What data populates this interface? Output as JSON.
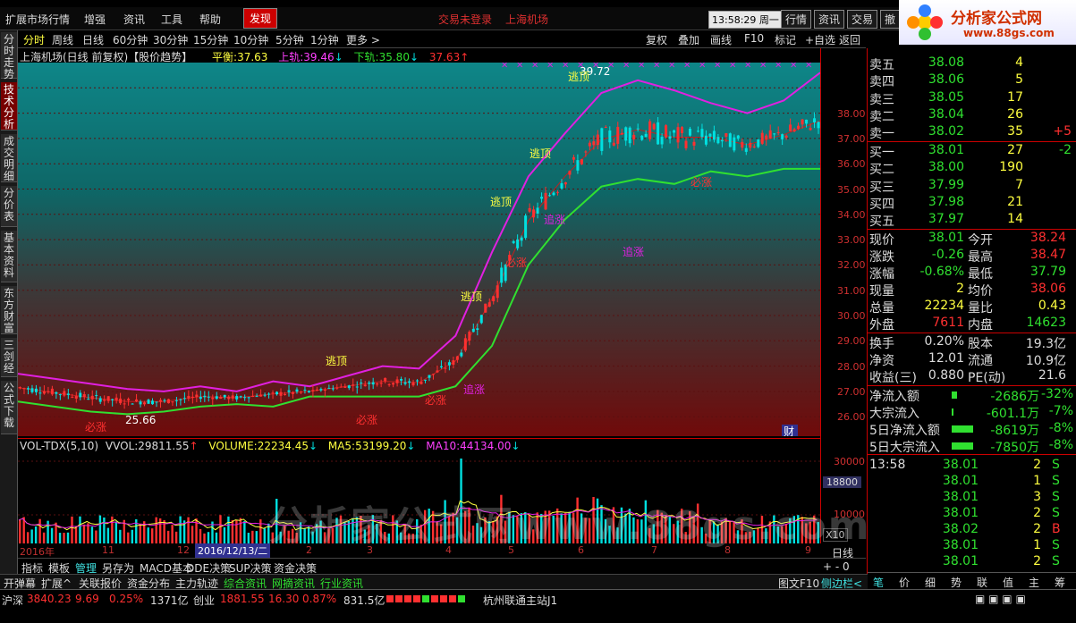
{
  "menubar": {
    "items": [
      "扩展市场行情",
      "增强",
      "资讯",
      "工具",
      "帮助"
    ],
    "active_tab": "发现",
    "status1": "交易未登录",
    "status2": "上海机场",
    "clock": "13:58:29 周一",
    "buttons": [
      "行情",
      "资讯",
      "交易",
      "撤"
    ]
  },
  "logo": {
    "title": "分析家公式网",
    "url": "www.88gs.com"
  },
  "toolbar": {
    "periods": [
      "分时",
      "周线",
      "日线",
      "60分钟",
      "30分钟",
      "15分钟",
      "10分钟",
      "5分钟",
      "1分钟",
      "更多 >"
    ],
    "tools": [
      "复权",
      "叠加",
      "画线",
      "F10",
      "标记",
      "+自选",
      "返回"
    ]
  },
  "left_rail": [
    "分时走势",
    "技术分析",
    "成交明细",
    "分价表",
    "基本资料",
    "东方财富",
    "三剑经",
    "公式下载"
  ],
  "chart_title": {
    "name": "上海机场(日线 前复权)【股价趋势】",
    "balance_label": "平衡:",
    "balance_value": "37.63",
    "upper_label": "上轨:",
    "upper_value": "39.46",
    "lower_label": "下轨:",
    "lower_value": "35.80",
    "extra_value": "37.63"
  },
  "price_axis": [
    "38.00",
    "37.00",
    "36.00",
    "35.00",
    "34.00",
    "33.00",
    "32.00",
    "31.00",
    "30.00",
    "29.00",
    "28.00",
    "27.00",
    "26.00"
  ],
  "annotations": {
    "high": "39.72",
    "low": "25.66",
    "escape": "逃顶",
    "chase": "追涨",
    "must": "必涨",
    "finance": "财"
  },
  "volume_title": {
    "indicator": "VOL-TDX(5,10)",
    "vvol_label": "VVOL:",
    "vvol_value": "29811.55",
    "volume_label": "VOLUME:",
    "volume_value": "22234.45",
    "ma5_label": "MA5:",
    "ma5_value": "53199.20",
    "ma10_label": "MA10:",
    "ma10_value": "44134.00"
  },
  "volume_axis": {
    "top": "30000",
    "mid": "18800",
    "low": "10000",
    "unit": "X10"
  },
  "date_bar": [
    "2016年",
    "11",
    "12",
    "2016/12/13/二",
    "2",
    "3",
    "4",
    "5",
    "6",
    "7",
    "8",
    "9"
  ],
  "period_label": "日线",
  "bottom_tabs": [
    "指标",
    "模板",
    "管理",
    "另存为",
    "MACD基本",
    "DDE决策",
    "SUP决策",
    "资金决策"
  ],
  "bottom_tabs2": [
    "开弹幕",
    "扩展^",
    "关联报价",
    "资金分布",
    "主力轨迹",
    "综合资讯",
    "网摘资讯",
    "行业资讯"
  ],
  "bottom_right": {
    "f10": "图文F10",
    "side": "侧边栏<"
  },
  "statusbar": {
    "sh_label": "沪深",
    "sh_index": "3840.23",
    "sh_change": "9.69",
    "sh_pct": "0.25%",
    "sh_amount": "1371亿",
    "cy_label": "创业",
    "cy_index": "1881.55",
    "cy_change": "16.30",
    "cy_pct": "0.87%",
    "cy_amount": "831.5亿",
    "server": "杭州联通主站J1"
  },
  "orderbook": {
    "sells": [
      {
        "label": "卖五",
        "price": "38.08",
        "vol": "4",
        "chg": ""
      },
      {
        "label": "卖四",
        "price": "38.06",
        "vol": "5",
        "chg": ""
      },
      {
        "label": "卖三",
        "price": "38.05",
        "vol": "17",
        "chg": ""
      },
      {
        "label": "卖二",
        "price": "38.04",
        "vol": "26",
        "chg": ""
      },
      {
        "label": "卖一",
        "price": "38.02",
        "vol": "35",
        "chg": "+5"
      }
    ],
    "buys": [
      {
        "label": "买一",
        "price": "38.01",
        "vol": "27",
        "chg": "-2"
      },
      {
        "label": "买二",
        "price": "38.00",
        "vol": "190",
        "chg": ""
      },
      {
        "label": "买三",
        "price": "37.99",
        "vol": "7",
        "chg": ""
      },
      {
        "label": "买四",
        "price": "37.98",
        "vol": "21",
        "chg": ""
      },
      {
        "label": "买五",
        "price": "37.97",
        "vol": "14",
        "chg": ""
      }
    ]
  },
  "stats": [
    {
      "l1": "现价",
      "v1": "38.01",
      "l2": "今开",
      "v2": "38.24"
    },
    {
      "l1": "涨跌",
      "v1": "-0.26",
      "l2": "最高",
      "v2": "38.47"
    },
    {
      "l1": "涨幅",
      "v1": "-0.68%",
      "l2": "最低",
      "v2": "37.79"
    },
    {
      "l1": "现量",
      "v1": "2",
      "l2": "均价",
      "v2": "38.06"
    },
    {
      "l1": "总量",
      "v1": "22234",
      "l2": "量比",
      "v2": "0.43"
    },
    {
      "l1": "外盘",
      "v1": "7611",
      "l2": "内盘",
      "v2": "14623"
    }
  ],
  "stats2": [
    {
      "l1": "换手",
      "v1": "0.20%",
      "l2": "股本",
      "v2": "19.3亿"
    },
    {
      "l1": "净资",
      "v1": "12.01",
      "l2": "流通",
      "v2": "10.9亿"
    },
    {
      "l1": "收益(三)",
      "v1": "0.880",
      "l2": "PE(动)",
      "v2": "21.6"
    }
  ],
  "flows": [
    {
      "label": "净流入额",
      "value": "-2686万",
      "pct": "-32%"
    },
    {
      "label": "大宗流入",
      "value": "-601.1万",
      "pct": "-7%"
    },
    {
      "label": "5日净流入额",
      "value": "-8619万",
      "pct": "-8%"
    },
    {
      "label": "5日大宗流入",
      "value": "-7850万",
      "pct": "-8%"
    }
  ],
  "ticks": [
    {
      "time": "13:58",
      "price": "38.01",
      "vol": "2",
      "side": "S"
    },
    {
      "time": "",
      "price": "38.01",
      "vol": "1",
      "side": "S"
    },
    {
      "time": "",
      "price": "38.01",
      "vol": "3",
      "side": "S"
    },
    {
      "time": "",
      "price": "38.01",
      "vol": "2",
      "side": "S"
    },
    {
      "time": "",
      "price": "38.02",
      "vol": "2",
      "side": "B"
    },
    {
      "time": "",
      "price": "38.01",
      "vol": "1",
      "side": "S"
    },
    {
      "time": "",
      "price": "38.01",
      "vol": "2",
      "side": "S"
    }
  ],
  "quote_tabs": [
    "笔",
    "价",
    "细",
    "势",
    "联",
    "值",
    "主",
    "筹"
  ],
  "watermark": "分析家公式网www.88gs.com",
  "colors": {
    "up": "#ff3030",
    "down": "#00e0e0",
    "green": "#30e030",
    "yellow": "#ffff40",
    "magenta": "#e020e0"
  },
  "chart_data": {
    "type": "line",
    "title": "上海机场(日线 前复权)【股价趋势】",
    "series": [
      {
        "name": "上轨",
        "values": [
          27.7,
          27.5,
          27.3,
          27.1,
          27.0,
          27.2,
          27.0,
          27.4,
          27.2,
          27.6,
          28.0,
          27.9,
          29.2,
          32.5,
          35.5,
          37.2,
          38.8,
          39.3,
          38.9,
          38.4,
          38.0,
          38.5,
          39.6
        ]
      },
      {
        "name": "下轨",
        "values": [
          26.6,
          26.4,
          26.2,
          26.1,
          26.2,
          26.4,
          26.5,
          26.4,
          26.8,
          26.8,
          26.8,
          26.8,
          27.2,
          28.8,
          32.0,
          33.8,
          35.1,
          35.4,
          35.2,
          35.7,
          35.5,
          35.8,
          35.8
        ]
      }
    ],
    "ylim": [
      25.5,
      40
    ]
  }
}
